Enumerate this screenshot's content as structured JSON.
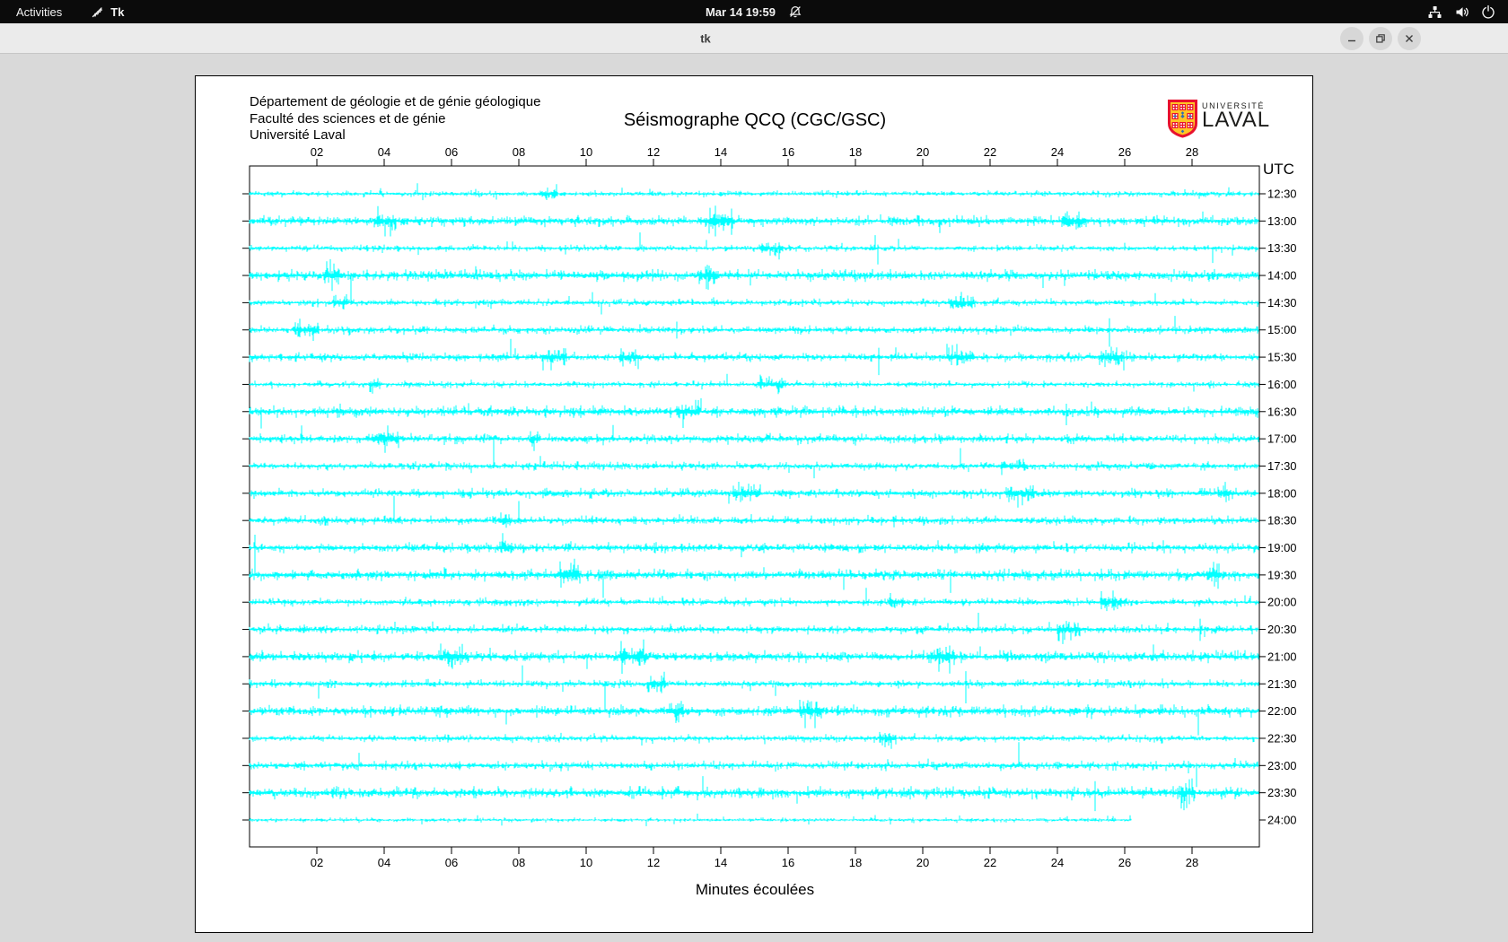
{
  "topbar": {
    "activities": "Activities",
    "app_name": "Tk",
    "clock": "Mar 14 19:59",
    "icons": [
      "bell-muted-icon",
      "network-wired-icon",
      "volume-icon",
      "power-icon"
    ]
  },
  "titlebar": {
    "title": "tk",
    "buttons": [
      "minimize",
      "restore",
      "close"
    ]
  },
  "header": {
    "dept_line1": "Département de géologie et de génie géologique",
    "dept_line2": "Faculté des sciences et de génie",
    "dept_line3": "Université Laval",
    "title": "Séismographe QCQ (CGC/GSC)"
  },
  "logo": {
    "line1": "UNIVERSITÉ",
    "line2": "LAVAL",
    "colors": {
      "red": "#e8112d",
      "gold": "#ffc425",
      "blue": "#2f6db5"
    }
  },
  "chart_data": {
    "type": "line",
    "subtype": "seismogram-helicorder",
    "title": "Séismographe QCQ (CGC/GSC)",
    "xlabel": "Minutes écoulées",
    "right_axis_label": "UTC",
    "right_axis_label_color": "#ff0000",
    "x_range_minutes": [
      0,
      30
    ],
    "x_ticks": [
      "02",
      "04",
      "06",
      "08",
      "10",
      "12",
      "14",
      "16",
      "18",
      "20",
      "22",
      "24",
      "26",
      "28"
    ],
    "trace_color": "#00ffff",
    "trace_labels": [
      "12:30",
      "13:00",
      "13:30",
      "14:00",
      "14:30",
      "15:00",
      "15:30",
      "16:00",
      "16:30",
      "17:00",
      "17:30",
      "18:00",
      "18:30",
      "19:00",
      "19:30",
      "20:00",
      "20:30",
      "21:00",
      "21:30",
      "22:00",
      "22:30",
      "23:00",
      "23:30",
      "24:00"
    ],
    "last_trace_end_minute": 26.2,
    "grid": false,
    "legend": false
  }
}
